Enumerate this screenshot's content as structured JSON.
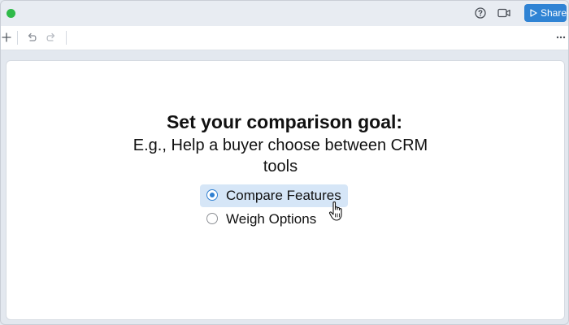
{
  "header": {
    "share_label": "Share"
  },
  "icons": {
    "status_dot": "green-dot",
    "help": "help-circle-icon",
    "video": "video-camera-icon",
    "share": "play-icon",
    "add": "plus-icon",
    "undo": "undo-icon",
    "redo": "redo-icon",
    "more": "more-horizontal-icon",
    "cursor": "hand-pointer-icon"
  },
  "colors": {
    "accent": "#2f83d4",
    "status_green": "#2fba49",
    "selected_bg": "#d6e6f7",
    "radio_checked": "#2f7fd1"
  },
  "main": {
    "title": "Set your comparison goal:",
    "example": "E.g., Help a buyer choose between CRM tools",
    "options": [
      {
        "label": "Compare Features",
        "selected": true
      },
      {
        "label": "Weigh Options",
        "selected": false
      }
    ]
  }
}
